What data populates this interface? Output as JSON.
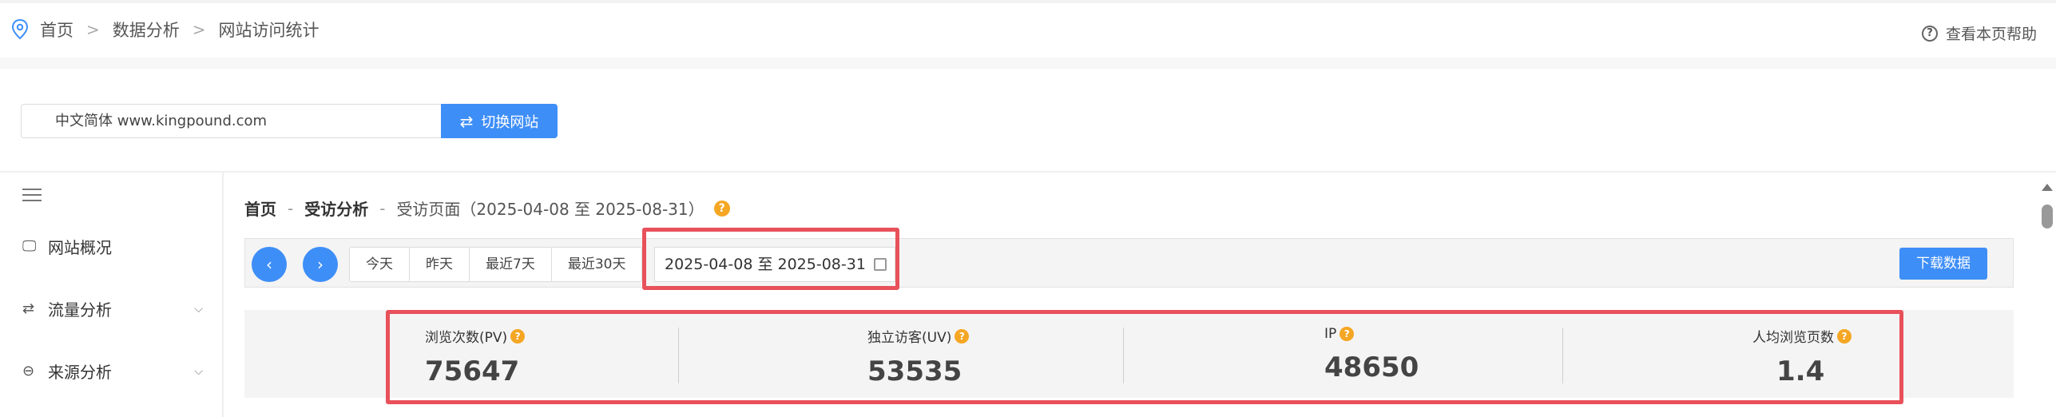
{
  "breadcrumb": {
    "items": [
      "首页",
      "数据分析",
      "网站访问统计"
    ]
  },
  "help": {
    "label": "查看本页帮助"
  },
  "site": {
    "value": "中文简体 www.kingpound.com",
    "switch_label": "切换网站"
  },
  "sidebar": {
    "items": [
      {
        "label": "网站概况",
        "icon": "monitor-icon"
      },
      {
        "label": "流量分析",
        "icon": "swap-icon"
      },
      {
        "label": "来源分析",
        "icon": "source-icon"
      }
    ]
  },
  "main": {
    "crumb_home": "首页",
    "crumb_section": "受访分析",
    "crumb_page": "受访页面（2025-04-08 至 2025-08-31）"
  },
  "toolbar": {
    "ranges": [
      "今天",
      "昨天",
      "最近7天",
      "最近30天"
    ],
    "date_range": "2025-04-08 至 2025-08-31",
    "download_label": "下载数据"
  },
  "stats": [
    {
      "label": "浏览次数(PV)",
      "value": "75647"
    },
    {
      "label": "独立访客(UV)",
      "value": "53535"
    },
    {
      "label": "IP",
      "value": "48650"
    },
    {
      "label": "人均浏览页数",
      "value": "1.4"
    }
  ],
  "colors": {
    "accent": "#3e8ef7",
    "highlight": "#e8515a",
    "help": "#f5a623"
  }
}
